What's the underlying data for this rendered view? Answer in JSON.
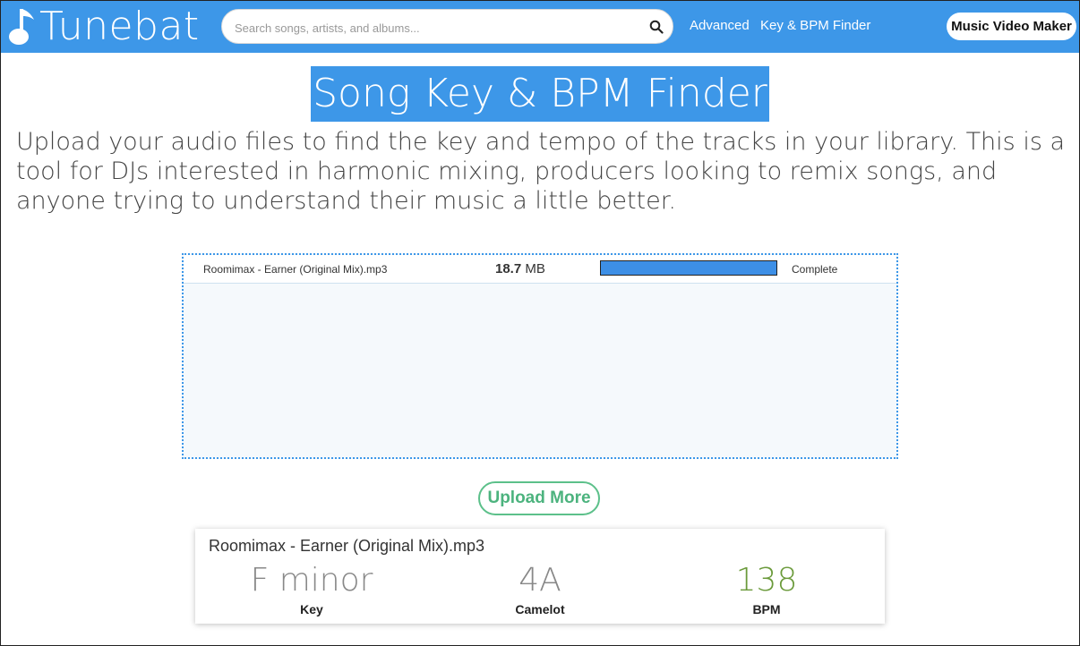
{
  "header": {
    "logo_text": "Tunebat",
    "search_placeholder": "Search songs, artists, and albums...",
    "nav": {
      "advanced": "Advanced",
      "key_bpm_finder": "Key & BPM Finder"
    },
    "music_video_maker": "Music Video Maker"
  },
  "page": {
    "title": "Song Key & BPM Finder",
    "intro": "Upload your audio files to find the key and tempo of the tracks in your library. This is a tool for DJs interested in harmonic mixing, producers looking to remix songs, and anyone trying to understand their music a little better."
  },
  "upload": {
    "file": {
      "name": "Roomimax - Earner (Original Mix).mp3",
      "size_value": "18.7",
      "size_unit": "MB",
      "progress_percent": 100,
      "status": "Complete"
    },
    "upload_more_label": "Upload More"
  },
  "result": {
    "file_name": "Roomimax - Earner (Original Mix).mp3",
    "key": {
      "value": "F minor",
      "label": "Key"
    },
    "camelot": {
      "value": "4A",
      "label": "Camelot"
    },
    "bpm": {
      "value": "138",
      "label": "BPM"
    }
  },
  "colors": {
    "brand": "#3d97e8",
    "accent_green": "#5cc08a",
    "bpm_green": "#6a9a3a"
  },
  "icons": {
    "logo": "music-note-icon",
    "search": "search-icon"
  }
}
